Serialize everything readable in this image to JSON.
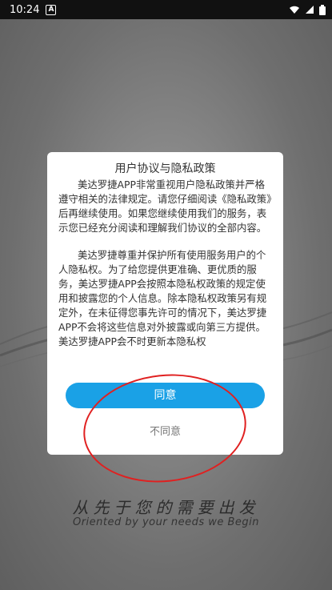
{
  "status_bar": {
    "time": "10:24",
    "notification_icon": "A",
    "icons": [
      "wifi-icon",
      "signal-icon",
      "battery-icon"
    ]
  },
  "dialog": {
    "title": "用户协议与隐私政策",
    "paragraph_1": "美达罗捷APP非常重视用户隐私政策并严格遵守相关的法律规定。请您仔细阅读《隐私政策》后再继续使用。如果您继续使用我们的服务，表示您已经充分阅读和理解我们协议的全部内容。",
    "paragraph_2": "美达罗捷尊重并保护所有使用服务用户的个人隐私权。为了给您提供更准确、更优质的服务，美达罗捷APP会按照本隐私权政策的规定使用和披露您的个人信息。除本隐私权政策另有规定外，在未征得您事先许可的情况下，美达罗捷APP不会将这些信息对外披露或向第三方提供。美达罗捷APP会不时更新本隐私权",
    "agree_label": "同意",
    "disagree_label": "不同意"
  },
  "background": {
    "slogan_cn": "从先于您的需要出发",
    "slogan_en": "Oriented by your needs we Begin"
  },
  "colors": {
    "primary_button": "#1aa1e6",
    "annotation_circle": "#e02020"
  }
}
